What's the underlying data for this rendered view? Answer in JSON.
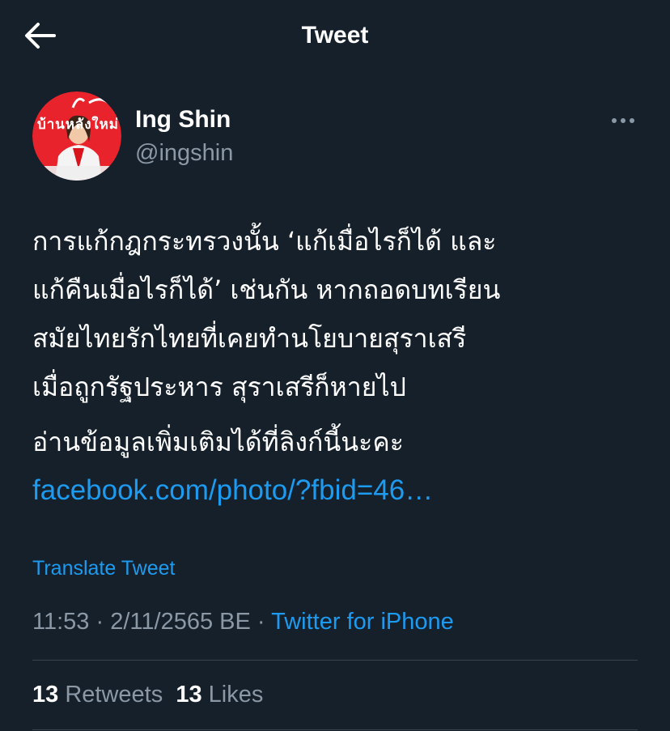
{
  "header": {
    "back_icon": "arrow-left-icon",
    "title": "Tweet"
  },
  "author": {
    "avatar_icon": "profile-photo",
    "avatar_logo_text": "บ้านหลังใหม่",
    "display_name": "Ing Shin",
    "handle": "@ingshin",
    "more_icon": "more-horizontal-icon"
  },
  "tweet": {
    "lines": [
      "การแก้กฎกระทรวงนั้น ‘แก้เมื่อไรก็ได้ และ",
      "แก้คืนเมื่อไรก็ได้’ เช่นกัน หากถอดบทเรียน",
      "สมัยไทยรักไทยที่เคยทำนโยบายสุราเสรี",
      "เมื่อถูกรัฐประหาร สุราเสรีก็หายไป"
    ],
    "line2": "อ่านข้อมูลเพิ่มเติมได้ที่ลิงก์นี้นะคะ",
    "link_text": "facebook.com/photo/?fbid=46…"
  },
  "translate_label": "Translate Tweet",
  "meta": {
    "time": "11:53",
    "date": "2/11/2565 BE",
    "separator": "·",
    "source": "Twitter for iPhone"
  },
  "stats": {
    "retweets_count": "13",
    "retweets_label": "Retweets",
    "likes_count": "13",
    "likes_label": "Likes"
  },
  "colors": {
    "background": "#15202b",
    "accent": "#1d9bf0",
    "secondary_text": "#8b98a5",
    "divider": "#38444d"
  }
}
